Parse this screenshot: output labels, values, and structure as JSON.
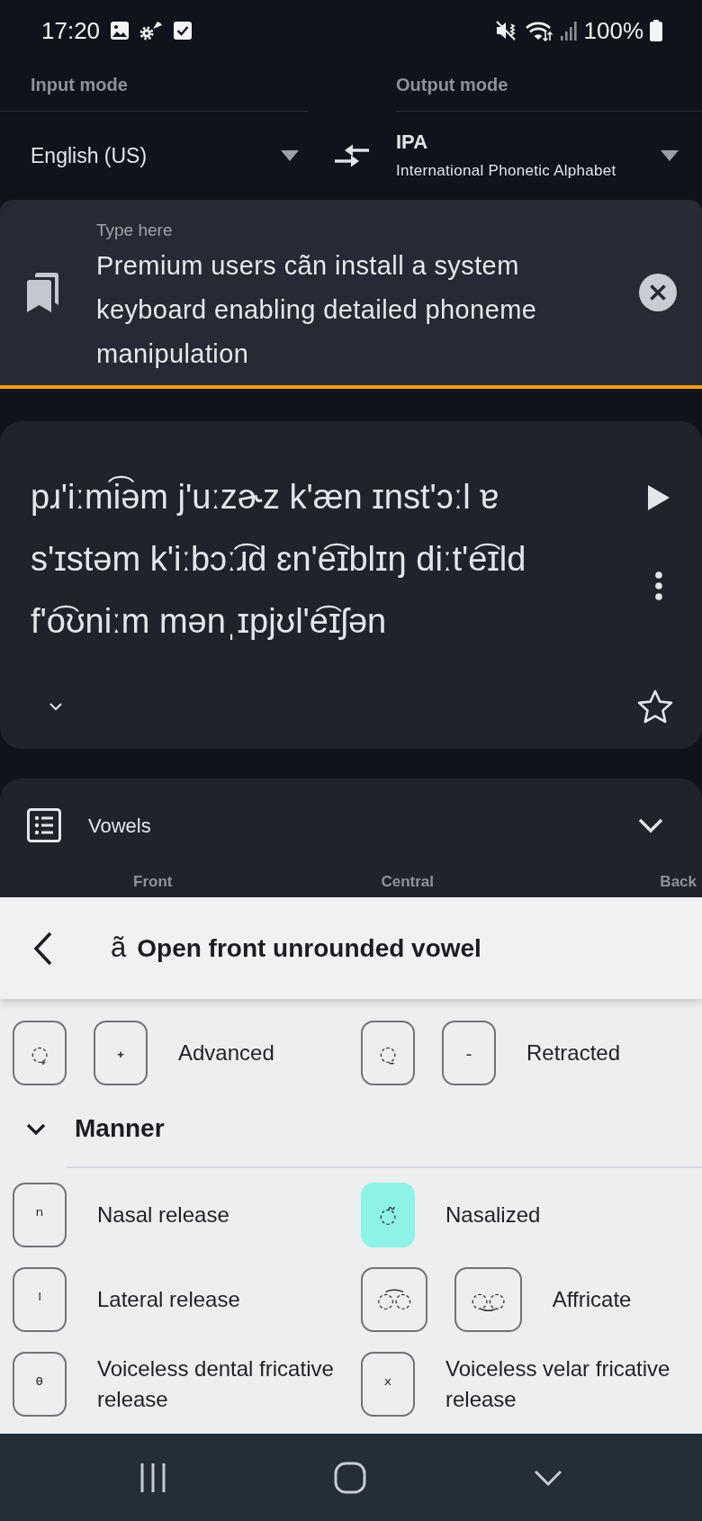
{
  "status_bar": {
    "time": "17:20",
    "battery": "100%"
  },
  "modes": {
    "input": {
      "label": "Input mode",
      "value": "English (US)"
    },
    "output": {
      "label": "Output mode",
      "value": "IPA",
      "subtitle": "International Phonetic Alphabet"
    }
  },
  "input": {
    "label": "Type here",
    "value": "Premium users cãn install a system keyboard enabling detailed phoneme manipulation"
  },
  "output": {
    "text": "pɹ'iːmi͡əm j'uːzɚz k'æn ɪnst'ɔːl ɐ s'ɪstəm k'iːbɔː͡ɹd ɛn'e͡ɪblɪŋ diːt'e͡ɪld f'o͡ʊniːm mənˌɪpjʊl'e͡ɪʃən",
    "starred": false
  },
  "vowels": {
    "title": "Vowels",
    "columns": [
      "Front",
      "Central",
      "Back"
    ]
  },
  "sheet": {
    "symbol": "ã",
    "title": "Open front unrounded vowel",
    "sections": [
      {
        "items": [
          {
            "keys": [
              {
                "glyph": "◌̟",
                "selected": false
              },
              {
                "glyph": "˖",
                "selected": false
              }
            ],
            "label": "Advanced"
          },
          {
            "keys": [
              {
                "glyph": "◌̠",
                "selected": false
              },
              {
                "glyph": "˗",
                "selected": false
              }
            ],
            "label": "Retracted"
          }
        ]
      },
      {
        "title": "Manner",
        "expanded": true,
        "items": [
          {
            "keys": [
              {
                "glyph": "ⁿ",
                "selected": false
              }
            ],
            "label": "Nasal release"
          },
          {
            "keys": [
              {
                "glyph": "◌̃",
                "selected": true
              }
            ],
            "label": "Nasalized"
          },
          {
            "keys": [
              {
                "glyph": "ˡ",
                "selected": false
              }
            ],
            "label": "Lateral release"
          },
          {
            "keys": [
              {
                "glyph": "◌͡◌",
                "selected": false
              },
              {
                "glyph": "◌͜◌",
                "selected": false
              }
            ],
            "label": "Affricate"
          },
          {
            "keys": [
              {
                "glyph": "ᶿ",
                "selected": false
              }
            ],
            "label": "Voiceless dental fricative release"
          },
          {
            "keys": [
              {
                "glyph": "ˣ",
                "selected": false
              }
            ],
            "label": "Voiceless velar fricative release"
          }
        ]
      }
    ]
  }
}
